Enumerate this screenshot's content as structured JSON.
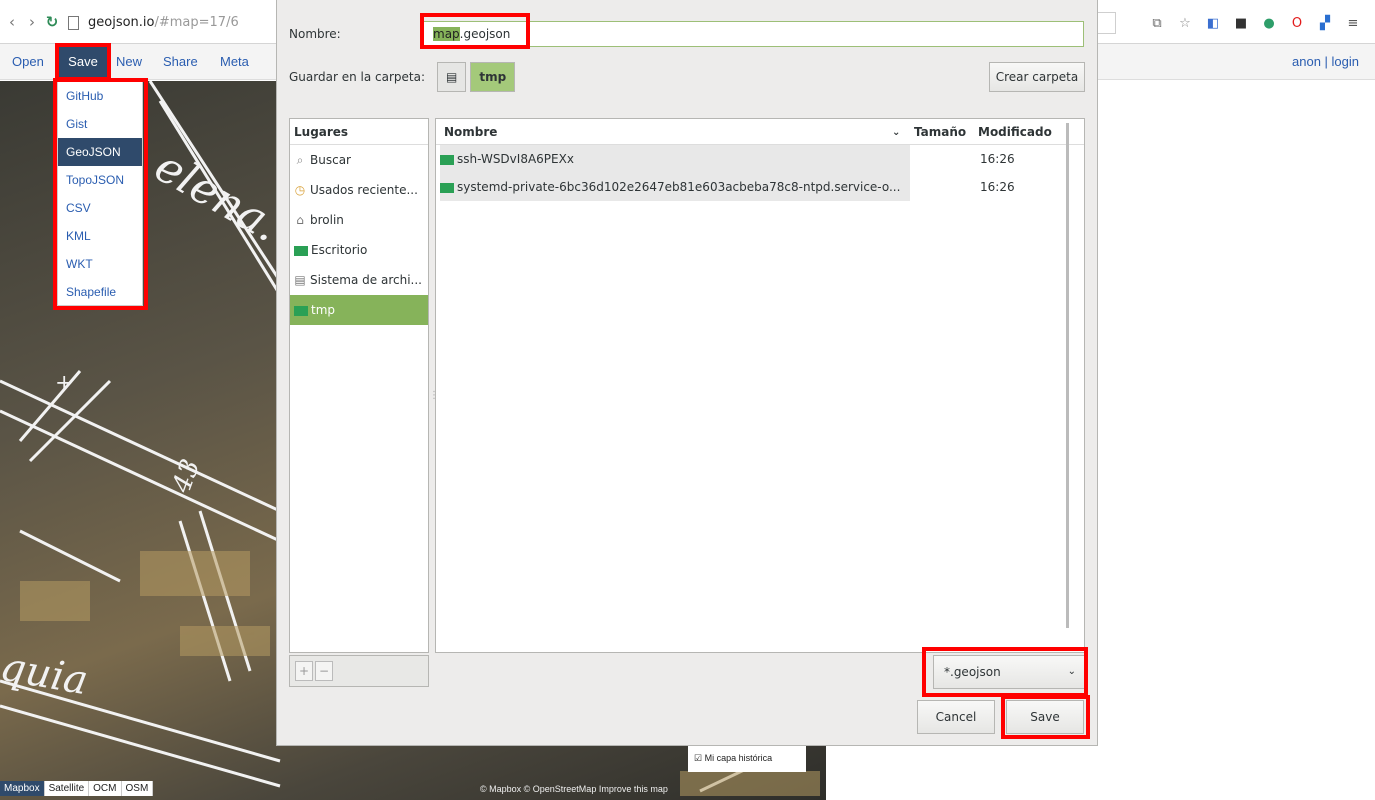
{
  "browser": {
    "url_host": "geojson.io",
    "url_rest": "/#map=17/6",
    "nav": {
      "back": "‹",
      "forward": "›",
      "reload": "↻"
    }
  },
  "app": {
    "open_label": "Open",
    "save_label": "Save",
    "new_label": "New",
    "share_label": "Share",
    "meta_label": "Meta",
    "auth_label": "anon | login"
  },
  "save_menu": {
    "items": [
      {
        "label": "GitHub"
      },
      {
        "label": "Gist"
      },
      {
        "label": "GeoJSON"
      },
      {
        "label": "TopoJSON"
      },
      {
        "label": "CSV"
      },
      {
        "label": "KML"
      },
      {
        "label": "WKT"
      },
      {
        "label": "Shapefile"
      }
    ]
  },
  "dialog": {
    "name_label": "Nombre:",
    "name_value_selected": "map",
    "name_value_ext": ".geojson",
    "folder_label": "Guardar en la carpeta:",
    "current_folder": "tmp",
    "create_folder_label": "Crear carpeta",
    "places_header": "Lugares",
    "places": [
      {
        "label": "Buscar",
        "icon": "search-icon"
      },
      {
        "label": "Usados reciente...",
        "icon": "clock-icon"
      },
      {
        "label": "brolin",
        "icon": "home-icon"
      },
      {
        "label": "Escritorio",
        "icon": "folder-icon"
      },
      {
        "label": "Sistema de archi...",
        "icon": "drive-icon"
      },
      {
        "label": "tmp",
        "icon": "folder-icon"
      }
    ],
    "columns": {
      "name": "Nombre",
      "size": "Tamaño",
      "modified": "Modificado"
    },
    "files": [
      {
        "name": "ssh-WSDvI8A6PEXx",
        "modified": "16:26"
      },
      {
        "name": "systemd-private-6bc36d102e2647eb81e603acbeba78c8-ntpd.service-o...",
        "modified": "16:26"
      }
    ],
    "add_label": "+",
    "remove_label": "−",
    "filter_value": "*.geojson",
    "cancel_label": "Cancel",
    "save_label": "Save"
  },
  "map": {
    "layers": [
      {
        "label": "Mapbox"
      },
      {
        "label": "Satellite"
      },
      {
        "label": "OCM"
      },
      {
        "label": "OSM"
      }
    ],
    "historic_layer_label": "Mi capa histórica",
    "attribution": "© Mapbox © OpenStreetMap Improve this map",
    "labels": [
      "elena.",
      "43",
      "quia",
      "+"
    ]
  },
  "colors": {
    "accent": "#2f4a6b",
    "link": "#2a5db0",
    "selection": "#86b35a",
    "highlight": "#ff0000"
  }
}
